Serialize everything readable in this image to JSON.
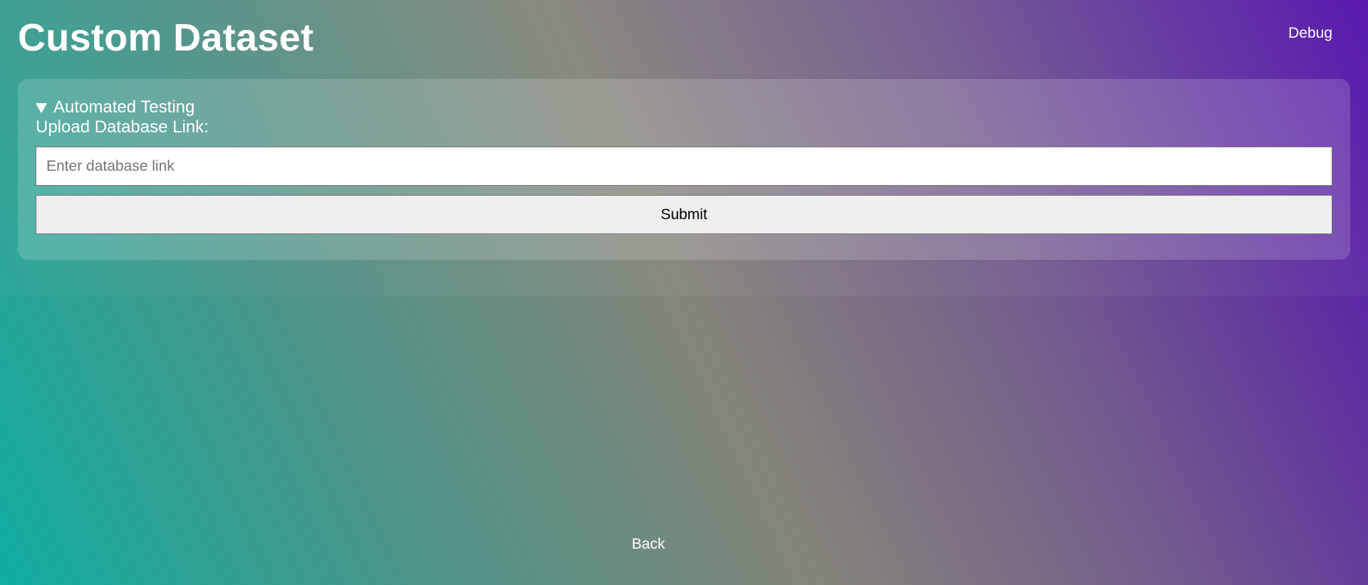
{
  "header": {
    "title": "Custom Dataset",
    "debug_label": "Debug"
  },
  "panel": {
    "summary": "Automated Testing",
    "field_label": "Upload Database Link:",
    "input_value": "",
    "input_placeholder": "Enter database link",
    "submit_label": "Submit"
  },
  "footer": {
    "back_label": "Back"
  },
  "icons": {
    "disclosure": "triangle-down-icon"
  },
  "colors": {
    "gradient_start": "#10ada0",
    "gradient_mid": "#85857a",
    "gradient_end": "#5210ac",
    "text": "#ffffff",
    "button_bg": "#efefef"
  }
}
